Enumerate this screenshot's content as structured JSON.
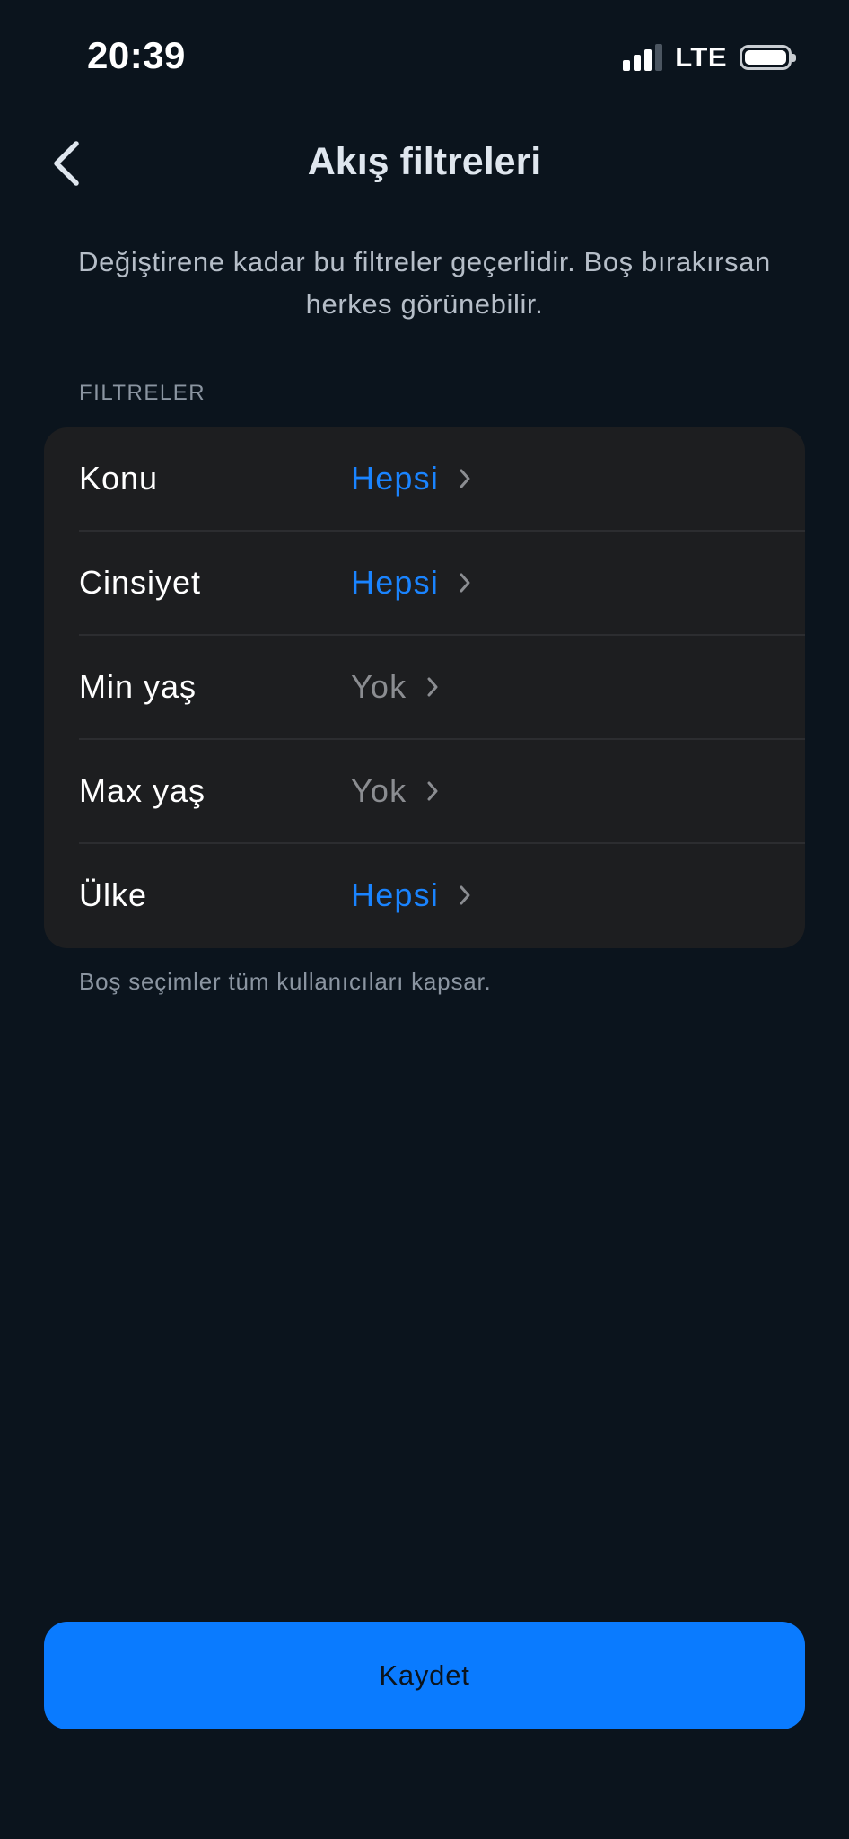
{
  "status_bar": {
    "time": "20:39",
    "network": "LTE",
    "signal_bars": 4,
    "signal_active": 3,
    "battery_level": 1.0
  },
  "nav": {
    "title": "Akış filtreleri",
    "back_icon": "chevron-left-icon"
  },
  "description": "Değiştirene kadar bu filtreler geçerlidir. Boş bırakırsan herkes görünebilir.",
  "filters": {
    "section_header": "FILTRELER",
    "items": [
      {
        "label": "Konu",
        "value": "Hepsi",
        "state": "active"
      },
      {
        "label": "Cinsiyet",
        "value": "Hepsi",
        "state": "active"
      },
      {
        "label": "Min yaş",
        "value": "Yok",
        "state": "empty"
      },
      {
        "label": "Max yaş",
        "value": "Yok",
        "state": "empty"
      },
      {
        "label": "Ülke",
        "value": "Hepsi",
        "state": "active"
      }
    ],
    "footnote": "Boş seçimler tüm kullanıcıları kapsar."
  },
  "actions": {
    "save_label": "Kaydet"
  },
  "colors": {
    "background": "#0b141d",
    "card": "#1d1e20",
    "accent": "#0a7bff",
    "active_value": "#1a84ff",
    "empty_value": "#8b8d91"
  }
}
